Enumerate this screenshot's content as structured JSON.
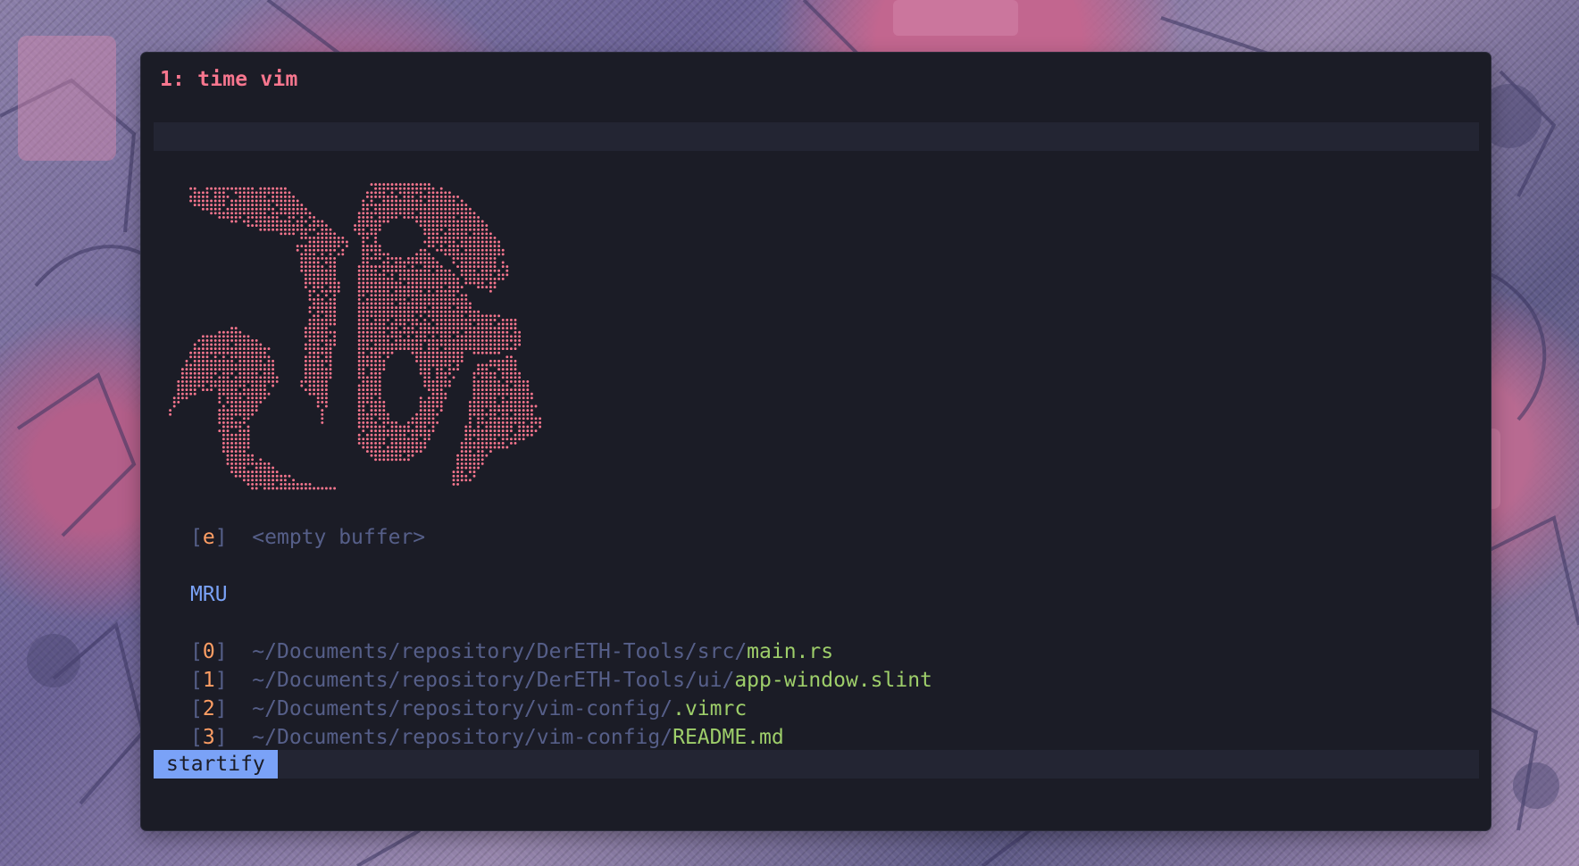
{
  "window": {
    "title": "1: time vim"
  },
  "startify": {
    "logo_name": "ascii-art-logo",
    "empty_buffer": {
      "open_bracket": "[",
      "key": "e",
      "close_bracket": "]",
      "label": "<empty buffer>"
    },
    "mru_heading": "MRU",
    "mru_items": [
      {
        "key": "0",
        "path": "~/Documents/repository/DerETH-Tools/src/",
        "file": "main.rs"
      },
      {
        "key": "1",
        "path": "~/Documents/repository/DerETH-Tools/ui/",
        "file": "app-window.slint"
      },
      {
        "key": "2",
        "path": "~/Documents/repository/vim-config/",
        "file": ".vimrc"
      },
      {
        "key": "3",
        "path": "~/Documents/repository/vim-config/",
        "file": "README.md"
      }
    ]
  },
  "statusline": {
    "mode": "startify"
  },
  "colors": {
    "title": "#f7768e",
    "logo": "#f7768e",
    "key": "#ff9e64",
    "path": "#565f89",
    "file": "#9ece6a",
    "heading": "#7aa2f7",
    "mode_bg": "#7aa2f7",
    "background": "#1b1c26"
  }
}
